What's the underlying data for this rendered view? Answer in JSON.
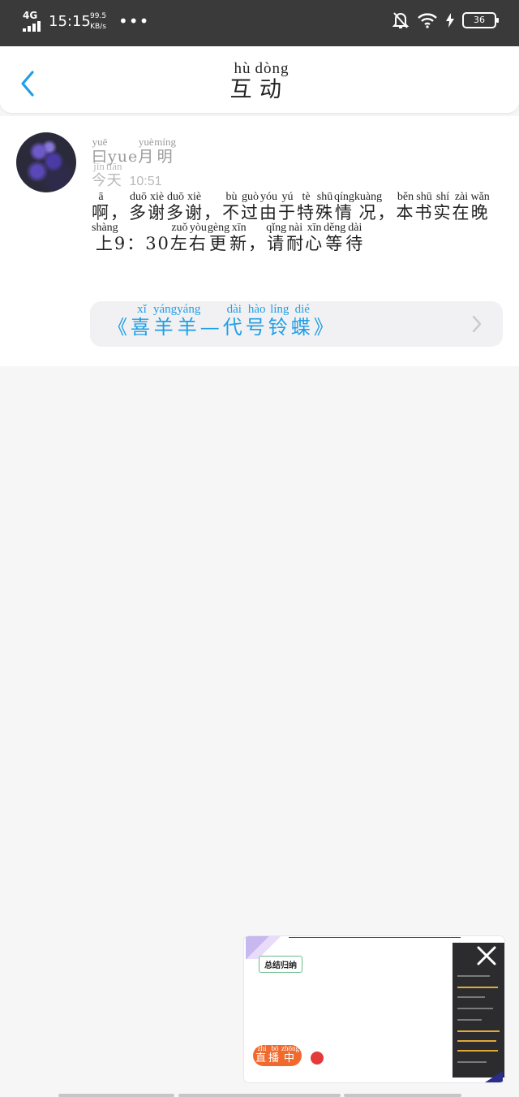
{
  "status_bar": {
    "network": "4G",
    "time": "15:15",
    "speed_value": "99.5",
    "speed_unit": "KB/s",
    "overflow": "•••",
    "battery": "36",
    "icons": [
      "signal-icon",
      "mute-bell-icon",
      "wifi-icon",
      "charging-icon",
      "battery-icon"
    ]
  },
  "header": {
    "title_chars": [
      {
        "hanzi": "互",
        "pinyin": "hù"
      },
      {
        "hanzi": "动",
        "pinyin": "dòng"
      }
    ],
    "back_icon": "chevron-left-icon",
    "accent_color": "#1f9ee6"
  },
  "post": {
    "username": [
      {
        "hanzi": "曰",
        "pinyin": "yuē"
      },
      {
        "text": "yue"
      },
      {
        "hanzi": "月",
        "pinyin": "yuè"
      },
      {
        "hanzi": "明",
        "pinyin": "míng"
      }
    ],
    "time_label": [
      {
        "hanzi": "今",
        "pinyin": "jīn"
      },
      {
        "hanzi": "天",
        "pinyin": "tiān"
      }
    ],
    "time_value": "10:51",
    "message": [
      {
        "hanzi": "啊",
        "pinyin": "ā"
      },
      {
        "text": "，"
      },
      {
        "hanzi": "多",
        "pinyin": "duō"
      },
      {
        "hanzi": "谢",
        "pinyin": "xiè"
      },
      {
        "hanzi": "多",
        "pinyin": "duō"
      },
      {
        "hanzi": "谢",
        "pinyin": "xiè"
      },
      {
        "text": "，"
      },
      {
        "hanzi": "不",
        "pinyin": "bù"
      },
      {
        "hanzi": "过",
        "pinyin": "guò"
      },
      {
        "hanzi": "由",
        "pinyin": "yóu"
      },
      {
        "hanzi": "于",
        "pinyin": "yú"
      },
      {
        "hanzi": "特",
        "pinyin": "tè"
      },
      {
        "hanzi": "殊",
        "pinyin": "shū"
      },
      {
        "hanzi": "情",
        "pinyin": "qíng"
      },
      {
        "hanzi": "况",
        "pinyin": "kuàng"
      },
      {
        "text": "，"
      },
      {
        "hanzi": "本",
        "pinyin": "běn"
      },
      {
        "hanzi": "书",
        "pinyin": "shū"
      },
      {
        "hanzi": "实",
        "pinyin": "shí"
      },
      {
        "hanzi": "在",
        "pinyin": "zài"
      },
      {
        "hanzi": "晚",
        "pinyin": "wǎn"
      },
      {
        "hanzi": "上",
        "pinyin": "shàng"
      },
      {
        "text": "9：30"
      },
      {
        "hanzi": "左",
        "pinyin": "zuǒ"
      },
      {
        "hanzi": "右",
        "pinyin": "yòu"
      },
      {
        "hanzi": "更",
        "pinyin": "gèng"
      },
      {
        "hanzi": "新",
        "pinyin": "xīn"
      },
      {
        "text": "，"
      },
      {
        "hanzi": "请",
        "pinyin": "qǐng"
      },
      {
        "hanzi": "耐",
        "pinyin": "nài"
      },
      {
        "hanzi": "心",
        "pinyin": "xīn"
      },
      {
        "hanzi": "等",
        "pinyin": "děng"
      },
      {
        "hanzi": "待",
        "pinyin": "dài"
      }
    ],
    "book": [
      {
        "text": "《"
      },
      {
        "hanzi": "喜",
        "pinyin": "xǐ"
      },
      {
        "hanzi": "羊",
        "pinyin": "yáng"
      },
      {
        "hanzi": "羊",
        "pinyin": "yáng"
      },
      {
        "text": "—"
      },
      {
        "hanzi": "代",
        "pinyin": "dài"
      },
      {
        "hanzi": "号",
        "pinyin": "hào"
      },
      {
        "hanzi": "铃",
        "pinyin": "líng"
      },
      {
        "hanzi": "蝶",
        "pinyin": "dié"
      },
      {
        "text": "》"
      }
    ],
    "book_chevron_icon": "chevron-right-icon"
  },
  "live_window": {
    "badge": "总结归纳",
    "status": [
      {
        "hanzi": "直",
        "pinyin": "zhí"
      },
      {
        "hanzi": "播",
        "pinyin": "bō"
      },
      {
        "hanzi": "中",
        "pinyin": "zhōng"
      }
    ],
    "close_icon": "close-icon",
    "status_color": "#f06a2e"
  }
}
